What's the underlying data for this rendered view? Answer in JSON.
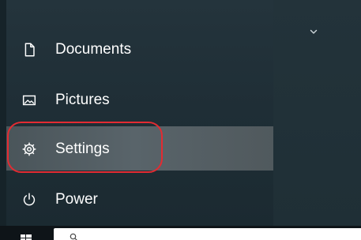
{
  "start_menu": {
    "items": [
      {
        "label": "Documents",
        "icon": "document-icon",
        "active": false
      },
      {
        "label": "Pictures",
        "icon": "pictures-icon",
        "active": false
      },
      {
        "label": "Settings",
        "icon": "gear-icon",
        "active": true
      },
      {
        "label": "Power",
        "icon": "power-icon",
        "active": false
      }
    ],
    "expand_icon": "chevron-down-icon"
  },
  "annotation": {
    "highlight_color": "#e32b32"
  },
  "taskbar": {
    "start_icon": "windows-icon",
    "search_icon": "search-icon",
    "search_placeholder": ""
  },
  "colors": {
    "menu_background": "#1f2e36",
    "active_item": "#59646a",
    "text": "#ffffff",
    "taskbar": "#0e1418",
    "search_box": "#ffffff"
  }
}
